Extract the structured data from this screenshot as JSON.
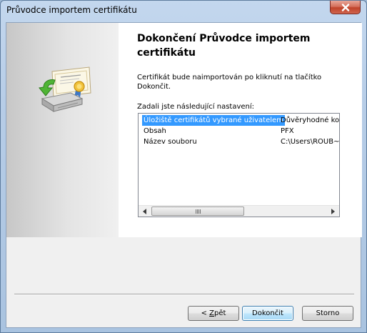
{
  "window": {
    "title": "Průvodce importem certifikátu"
  },
  "page": {
    "heading": "Dokončení Průvodce importem certifikátu",
    "description": "Certifikát bude naimportován po kliknutí na tlačítko Dokončit.",
    "settings_label": "Zadali jste následující nastavení:"
  },
  "settings": [
    {
      "name": "Úložiště certifikátů vybrané uživatelem",
      "value": "Důvěryhodné koř",
      "selected": true
    },
    {
      "name": "Obsah",
      "value": "PFX",
      "selected": false
    },
    {
      "name": "Název souboru",
      "value": "C:\\Users\\ROUB~",
      "selected": false
    }
  ],
  "buttons": {
    "back": {
      "prefix": "< ",
      "accel": "Z",
      "rest": "pět"
    },
    "finish": "Dokončit",
    "cancel": "Storno"
  },
  "icons": {
    "wizard": "certificate-import-icon",
    "close": "close-icon"
  },
  "colors": {
    "selection": "#3399ff",
    "close_button": "#c0432a",
    "default_button_border": "#3c7fb1"
  }
}
